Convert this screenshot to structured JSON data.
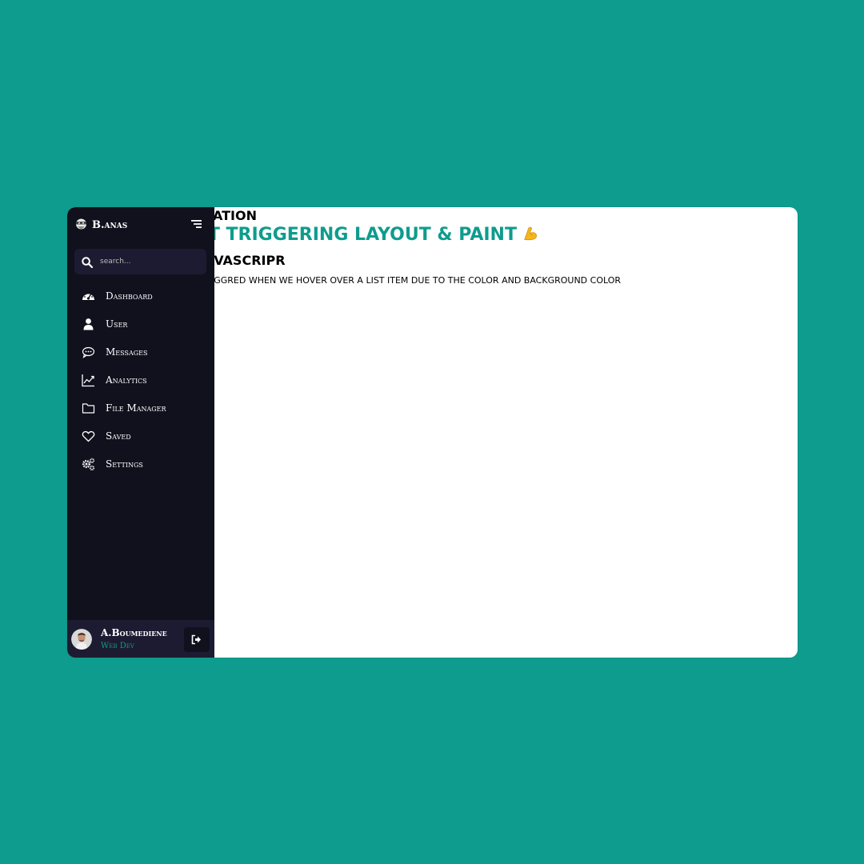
{
  "article": {
    "line1": "ATION",
    "line2": "UT TRIGGERING LAYOUT & PAINT",
    "line3": "JAVASCRIPR",
    "line4": "IGGRED WHEN WE HOVER OVER A LIST ITEM DUE TO THE COLOR AND BACKGROUND COLOR"
  },
  "sidebar": {
    "brand": "B.anas",
    "search_placeholder": "search...",
    "items": [
      {
        "label": "Dashboard",
        "icon": "dashboard-icon"
      },
      {
        "label": "User",
        "icon": "user-icon"
      },
      {
        "label": "Messages",
        "icon": "messages-icon"
      },
      {
        "label": "Analytics",
        "icon": "analytics-icon"
      },
      {
        "label": "File Manager",
        "icon": "folder-icon"
      },
      {
        "label": "Saved",
        "icon": "heart-icon"
      },
      {
        "label": "Settings",
        "icon": "settings-icon"
      }
    ],
    "profile": {
      "name": "A.Boumediene",
      "role": "Web Dev"
    }
  },
  "colors": {
    "background": "#0e9c8e",
    "sidebar": "#11101d",
    "sidebar_panel": "#1d1b31",
    "accent": "#0e9c8e"
  }
}
